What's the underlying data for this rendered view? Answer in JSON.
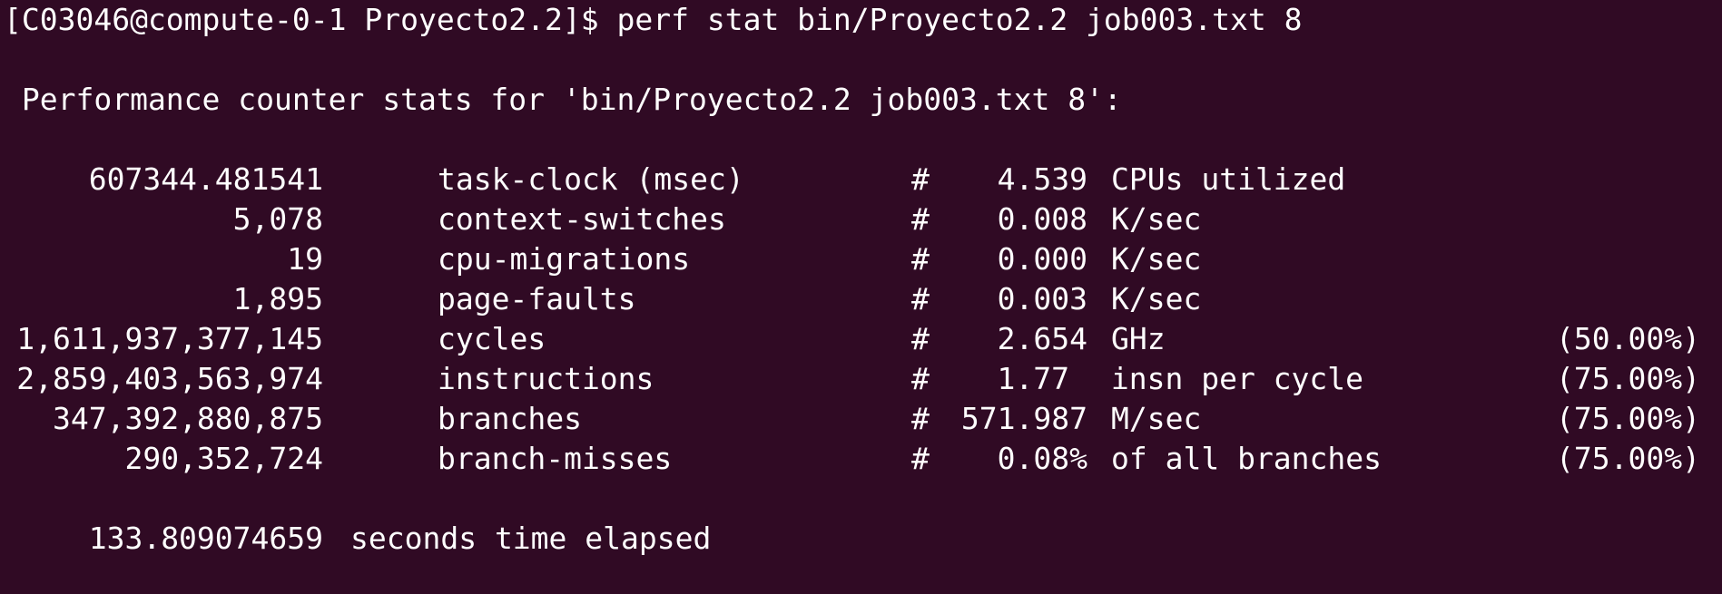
{
  "prompt": {
    "text": "[C03046@compute-0-1 Proyecto2.2]$ perf stat bin/Proyecto2.2 job003.txt 8"
  },
  "header": {
    "text": " Performance counter stats for 'bin/Proyecto2.2 job003.txt 8':"
  },
  "counters": [
    {
      "value": "607344.481541",
      "name": "task-clock (msec)",
      "hash": "#",
      "metric": "4.539",
      "unit": "CPUs utilized",
      "pct": ""
    },
    {
      "value": "5,078",
      "name": "context-switches",
      "hash": "#",
      "metric": "0.008",
      "unit": "K/sec",
      "pct": ""
    },
    {
      "value": "19",
      "name": "cpu-migrations",
      "hash": "#",
      "metric": "0.000",
      "unit": "K/sec",
      "pct": ""
    },
    {
      "value": "1,895",
      "name": "page-faults",
      "hash": "#",
      "metric": "0.003",
      "unit": "K/sec",
      "pct": ""
    },
    {
      "value": "1,611,937,377,145",
      "name": "cycles",
      "hash": "#",
      "metric": "2.654",
      "unit": "GHz",
      "pct": "(50.00%)"
    },
    {
      "value": "2,859,403,563,974",
      "name": "instructions",
      "hash": "#",
      "metric": "1.77",
      "unit": " insn per cycle",
      "pct": "(75.00%)"
    },
    {
      "value": "347,392,880,875",
      "name": "branches",
      "hash": "#",
      "metric": "571.987",
      "unit": "M/sec",
      "pct": "(75.00%)"
    },
    {
      "value": "290,352,724",
      "name": "branch-misses",
      "hash": "#",
      "metric": "0.08%",
      "unit": "of all branches",
      "pct": "(75.00%)"
    }
  ],
  "elapsed": {
    "value": "133.809074659",
    "text": "seconds time elapsed"
  },
  "colors": {
    "background": "#300a24",
    "foreground": "#ffffff"
  }
}
